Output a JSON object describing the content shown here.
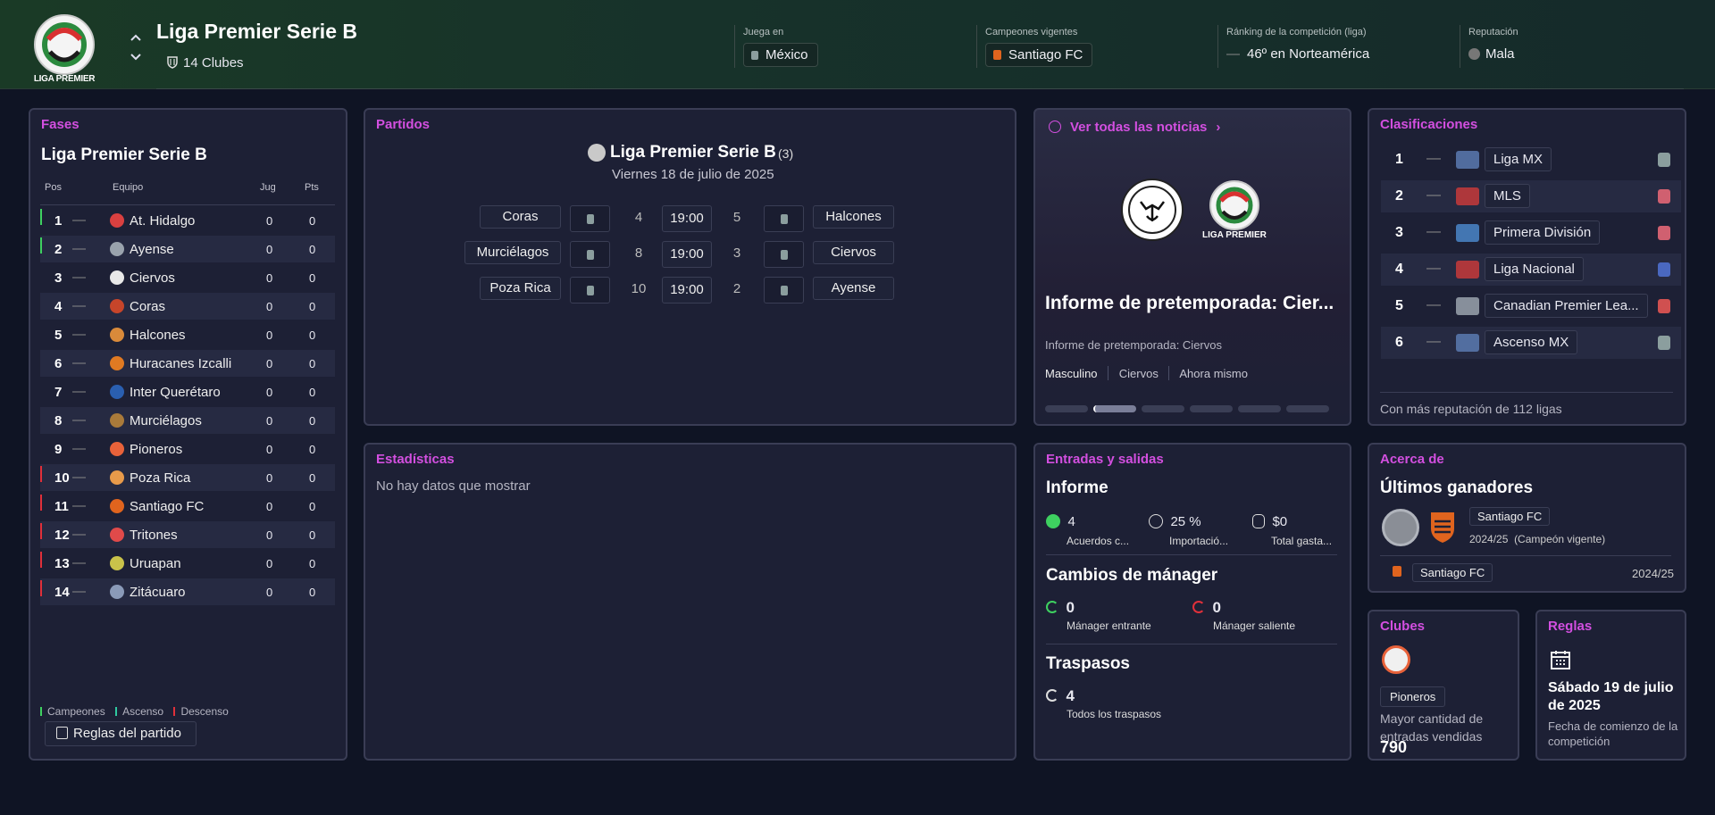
{
  "header": {
    "league_name": "Liga Premier Serie B",
    "clubs_count": "14",
    "clubs_label": "Clubes",
    "logo_text": "LIGA PREMIER",
    "plays_in_label": "Juega en",
    "plays_in_value": "México",
    "champions_label": "Campeones vigentes",
    "champions_value": "Santiago FC",
    "ranking_label": "Ránking de la competición (liga)",
    "ranking_value": "46º en Norteamérica",
    "reputation_label": "Reputación",
    "reputation_value": "Mala"
  },
  "fases": {
    "title": "Fases",
    "league": "Liga Premier Serie B",
    "col_pos": "Pos",
    "col_team": "Equipo",
    "col_jug": "Jug",
    "col_pts": "Pts",
    "rows": [
      {
        "pos": "1",
        "team": "At. Hidalgo",
        "jug": "0",
        "pts": "0",
        "zone": "green",
        "color": "#d94040"
      },
      {
        "pos": "2",
        "team": "Ayense",
        "jug": "0",
        "pts": "0",
        "zone": "green",
        "color": "#9aa3ad"
      },
      {
        "pos": "3",
        "team": "Ciervos",
        "jug": "0",
        "pts": "0",
        "zone": "",
        "color": "#e8e8e8"
      },
      {
        "pos": "4",
        "team": "Coras",
        "jug": "0",
        "pts": "0",
        "zone": "",
        "color": "#c7452a"
      },
      {
        "pos": "5",
        "team": "Halcones",
        "jug": "0",
        "pts": "0",
        "zone": "",
        "color": "#d98a3a"
      },
      {
        "pos": "6",
        "team": "Huracanes Izcalli",
        "jug": "0",
        "pts": "0",
        "zone": "",
        "color": "#e07a22"
      },
      {
        "pos": "7",
        "team": "Inter Querétaro",
        "jug": "0",
        "pts": "0",
        "zone": "",
        "color": "#2a5fb0"
      },
      {
        "pos": "8",
        "team": "Murciélagos",
        "jug": "0",
        "pts": "0",
        "zone": "",
        "color": "#a97a3a"
      },
      {
        "pos": "9",
        "team": "Pioneros",
        "jug": "0",
        "pts": "0",
        "zone": "",
        "color": "#e8623a"
      },
      {
        "pos": "10",
        "team": "Poza Rica",
        "jug": "0",
        "pts": "0",
        "zone": "red",
        "color": "#e89a4a"
      },
      {
        "pos": "11",
        "team": "Santiago FC",
        "jug": "0",
        "pts": "0",
        "zone": "red",
        "color": "#e0641e"
      },
      {
        "pos": "12",
        "team": "Tritones",
        "jug": "0",
        "pts": "0",
        "zone": "red",
        "color": "#e04a4a"
      },
      {
        "pos": "13",
        "team": "Uruapan",
        "jug": "0",
        "pts": "0",
        "zone": "red",
        "color": "#c9c24a"
      },
      {
        "pos": "14",
        "team": "Zitácuaro",
        "jug": "0",
        "pts": "0",
        "zone": "red",
        "color": "#8a9ab8"
      }
    ],
    "legend_champions": "Campeones",
    "legend_promotion": "Ascenso",
    "legend_relegation": "Descenso",
    "rules_button": "Reglas del partido"
  },
  "partidos": {
    "title": "Partidos",
    "league": "Liga Premier Serie B",
    "count": "(3)",
    "date": "Viernes 18 de julio de 2025",
    "matches": [
      {
        "home": "Coras",
        "home_rank": "4",
        "time": "19:00",
        "away_rank": "5",
        "away": "Halcones"
      },
      {
        "home": "Murciélagos",
        "home_rank": "8",
        "time": "19:00",
        "away_rank": "3",
        "away": "Ciervos"
      },
      {
        "home": "Poza Rica",
        "home_rank": "10",
        "time": "19:00",
        "away_rank": "2",
        "away": "Ayense"
      }
    ]
  },
  "news": {
    "link": "Ver todas las noticias",
    "logo_right_text": "LIGA PREMIER",
    "headline": "Informe de pretemporada: Cier...",
    "subtitle": "Informe de pretemporada: Ciervos",
    "tags": [
      "Masculino",
      "Ciervos",
      "Ahora mismo"
    ]
  },
  "clasificaciones": {
    "title": "Clasificaciones",
    "rows": [
      {
        "n": "1",
        "name": "Liga MX",
        "logo_color": "#5a7ab0",
        "icon_color": "#8b9e9e"
      },
      {
        "n": "2",
        "name": "MLS",
        "logo_color": "#c73a3a",
        "icon_color": "#d06070"
      },
      {
        "n": "3",
        "name": "Primera División",
        "logo_color": "#4a86c8",
        "icon_color": "#d06070"
      },
      {
        "n": "4",
        "name": "Liga Nacional",
        "logo_color": "#c73a3a",
        "icon_color": "#4a68c0"
      },
      {
        "n": "5",
        "name": "Canadian Premier Lea...",
        "logo_color": "#9aa3ad",
        "icon_color": "#d05050"
      },
      {
        "n": "6",
        "name": "Ascenso MX",
        "logo_color": "#5a7ab0",
        "icon_color": "#8b9e9e"
      }
    ],
    "footer": "Con más reputación de 112 ligas"
  },
  "estadisticas": {
    "title": "Estadísticas",
    "empty": "No hay datos que mostrar"
  },
  "entradas": {
    "title": "Entradas y salidas",
    "informe": "Informe",
    "stat1_value": "4",
    "stat1_label": "Acuerdos c...",
    "stat2_value": "25 %",
    "stat2_label": "Importació...",
    "stat3_value": "$0",
    "stat3_label": "Total gasta...",
    "managers_title": "Cambios de mánager",
    "mgr_in_value": "0",
    "mgr_in_label": "Mánager entrante",
    "mgr_out_value": "0",
    "mgr_out_label": "Mánager saliente",
    "transfers_title": "Traspasos",
    "transfers_value": "4",
    "transfers_label": "Todos los traspasos"
  },
  "acerca": {
    "title": "Acerca de",
    "subtitle": "Últimos ganadores",
    "winner": "Santiago FC",
    "season_text": "2024/25",
    "season_note": "(Campeón vigente)",
    "row_team": "Santiago FC",
    "row_season": "2024/25"
  },
  "clubes": {
    "title": "Clubes",
    "club": "Pioneros",
    "desc": "Mayor cantidad de entradas vendidas",
    "value": "790"
  },
  "reglas": {
    "title": "Reglas",
    "date": "Sábado 19 de julio de 2025",
    "desc": "Fecha de comienzo de la competición"
  },
  "colors": {
    "accent": "#d34fe0",
    "champions": "#3ed060",
    "promotion": "#2fc9a0",
    "relegation": "#e0303a"
  }
}
